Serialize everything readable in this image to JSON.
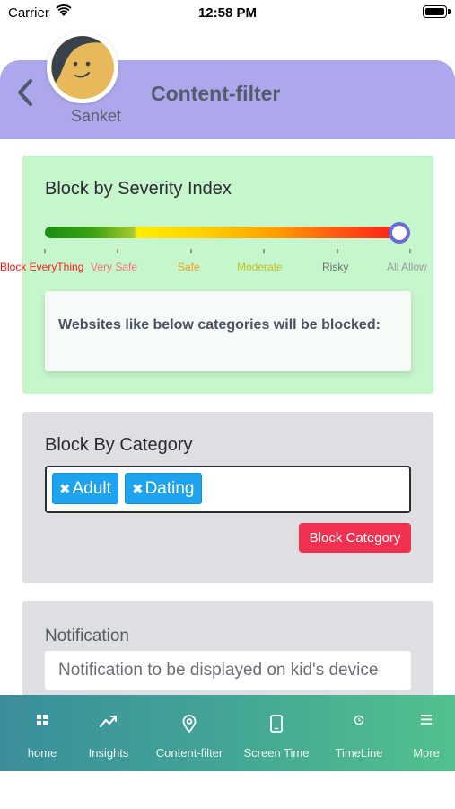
{
  "status_bar": {
    "carrier": "Carrier",
    "time": "12:58 PM"
  },
  "header": {
    "user_name": "Sanket",
    "title": "Content-filter"
  },
  "severity": {
    "title": "Block by Severity Index",
    "levels": [
      {
        "label": "Block EveryThing",
        "color": "#ff1a1a"
      },
      {
        "label": "Very Safe",
        "color": "#f7707a"
      },
      {
        "label": "Safe",
        "color": "#f0a21a"
      },
      {
        "label": "Moderate",
        "color": "#c5c11c"
      },
      {
        "label": "Risky",
        "color": "#707070"
      },
      {
        "label": "All Allow",
        "color": "#9a9a9a"
      }
    ],
    "selected_level": "All Allow",
    "info_text": "Websites like below categories will be blocked:"
  },
  "category": {
    "title": "Block By Category",
    "tags": [
      {
        "label": "Adult"
      },
      {
        "label": "Dating"
      }
    ],
    "remove_glyph": "✖",
    "button_label": "Block Category"
  },
  "notification": {
    "title": "Notification",
    "placeholder": "Notification to be displayed on kid's device"
  },
  "tabs": [
    {
      "label": "home",
      "icon": "grid-icon"
    },
    {
      "label": "Insights",
      "icon": "chart-icon"
    },
    {
      "label": "Content-filter",
      "icon": "location-pin-icon"
    },
    {
      "label": "Screen Time",
      "icon": "phone-icon"
    },
    {
      "label": "TimeLine",
      "icon": "clock-icon"
    },
    {
      "label": "More",
      "icon": "menu-icon"
    }
  ],
  "colors": {
    "header": "#ada8ec",
    "severity_card": "#c6f6cb",
    "category_card": "#dedfe2",
    "tag": "#1ea3ef",
    "block_button": "#f2304f",
    "slider_thumb": "#6b6bd6"
  }
}
